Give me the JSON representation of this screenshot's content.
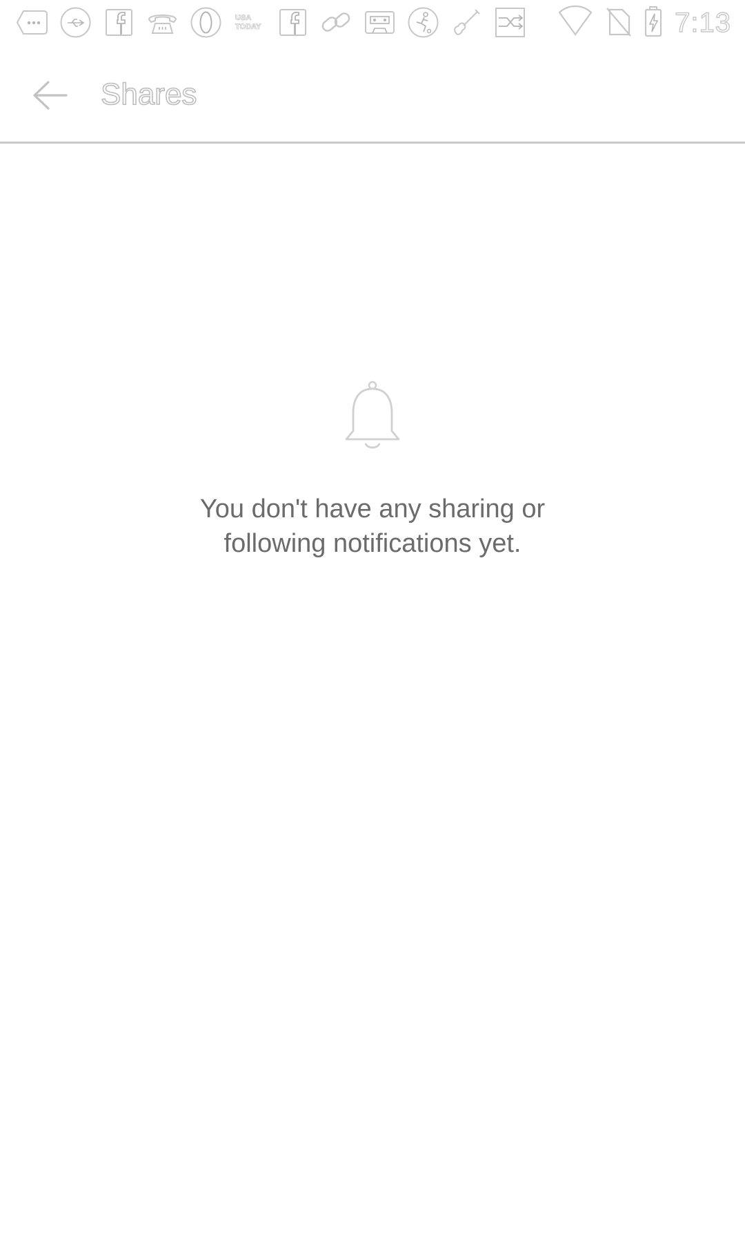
{
  "status_bar": {
    "notification_icons": [
      "more-dots-icon",
      "usb-icon",
      "facebook-icon",
      "telephone-icon",
      "opera-icon",
      "usa-today-icon",
      "facebook-icon",
      "link-icon",
      "cassette-icon",
      "soccer-icon",
      "violin-icon",
      "split-arrow-icon"
    ],
    "usa_today_label": "USA TODAY",
    "time": "7:13"
  },
  "app_bar": {
    "title": "Shares"
  },
  "empty_state": {
    "icon": "bell-icon",
    "message": "You don't have any sharing or following notifications yet."
  },
  "colors": {
    "outline": "#c7c7c7",
    "text_gray": "#6b6b6b",
    "divider": "#c9c9c9",
    "background": "#ffffff"
  }
}
